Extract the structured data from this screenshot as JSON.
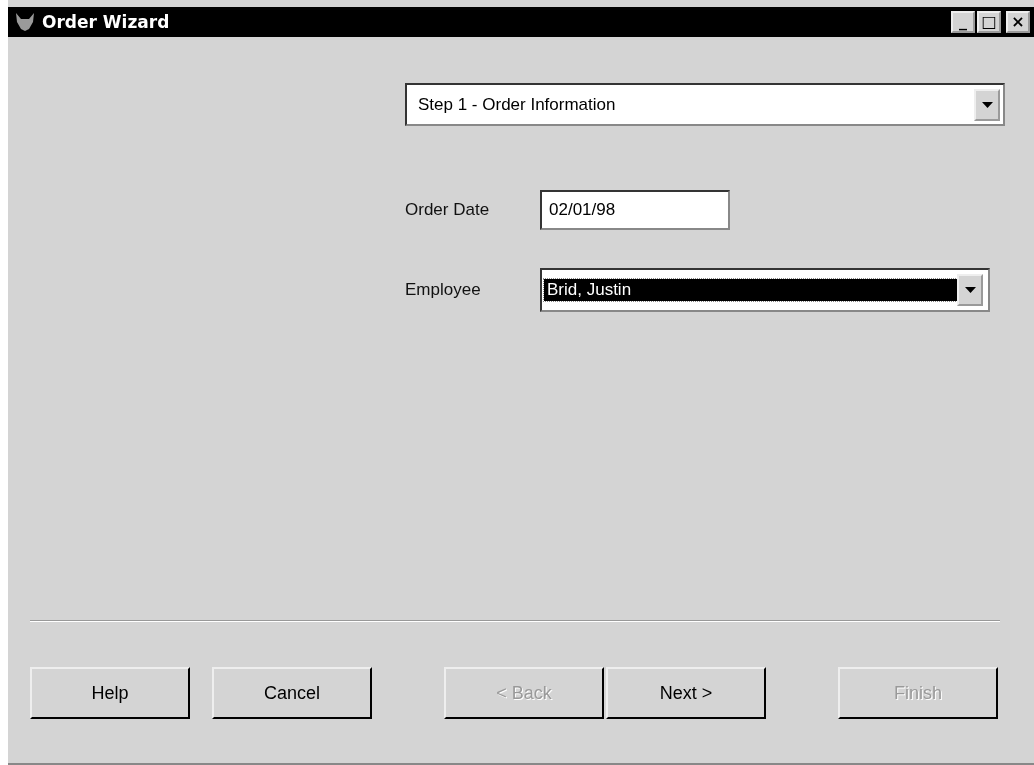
{
  "window": {
    "title": "Order Wizard",
    "controls": [
      "_",
      "□",
      "×"
    ]
  },
  "step_select": {
    "value": "Step 1 - Order Information"
  },
  "fields": [
    {
      "kind": "text",
      "label": "Order Date",
      "value": "02/01/98",
      "focused": false
    },
    {
      "kind": "select",
      "label": "Employee",
      "value": "Brid, Justin",
      "focused": true
    }
  ],
  "button_groups": [
    [
      {
        "label": "Help",
        "disabled": false
      },
      {
        "label": "Cancel",
        "disabled": false
      }
    ],
    [
      {
        "label": "< Back",
        "disabled": true
      },
      {
        "label": "Next >",
        "disabled": false
      }
    ],
    [
      {
        "label": "Finish",
        "disabled": true
      }
    ]
  ]
}
